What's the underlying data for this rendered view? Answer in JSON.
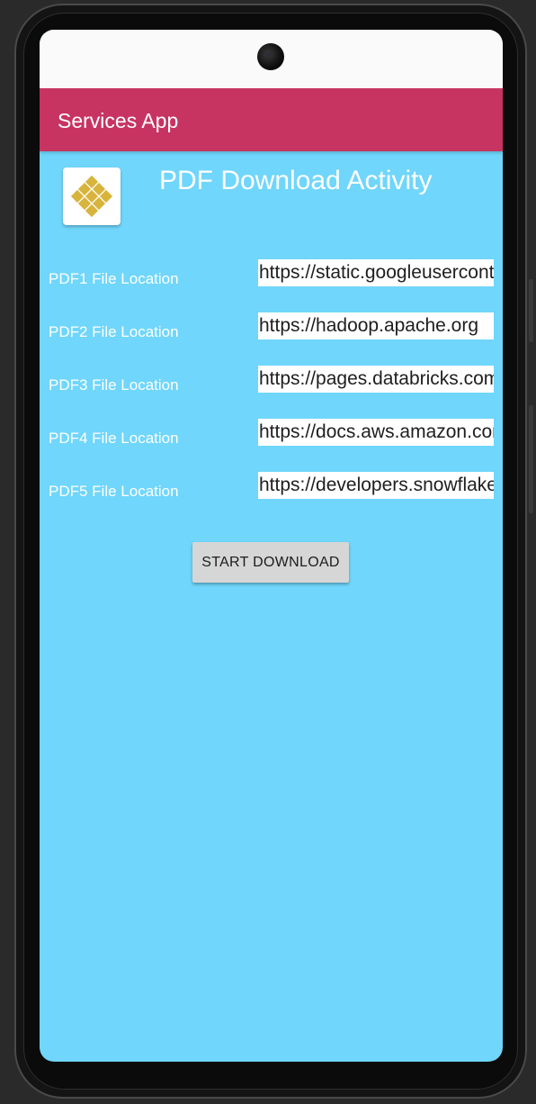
{
  "app_bar": {
    "title": "Services App",
    "color": "#c73462"
  },
  "header": {
    "icon": "app-logo-icon",
    "title": "PDF Download Activity"
  },
  "colors": {
    "background": "#70d6fb",
    "status_bar": "#fafafa",
    "button": "#d6d6d6"
  },
  "pdf_fields": [
    {
      "label": "PDF1 File Location",
      "value": "https://static.googleusercontent.com"
    },
    {
      "label": "PDF2 File Location",
      "value": "https://hadoop.apache.org"
    },
    {
      "label": "PDF3 File Location",
      "value": "https://pages.databricks.com"
    },
    {
      "label": "PDF4 File Location",
      "value": "https://docs.aws.amazon.com"
    },
    {
      "label": "PDF5 File Location",
      "value": "https://developers.snowflake.com"
    }
  ],
  "start_button": {
    "label": "START DOWNLOAD"
  }
}
